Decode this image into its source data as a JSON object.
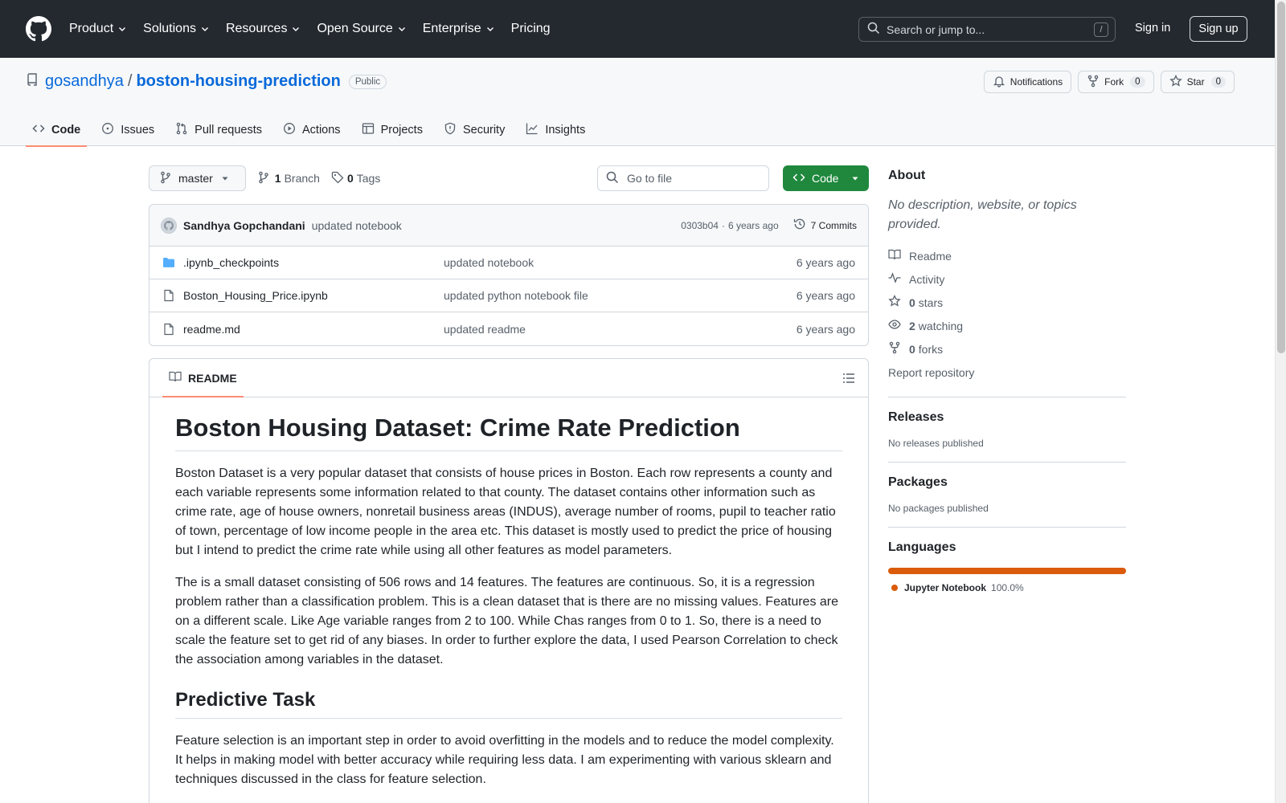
{
  "header": {
    "nav": [
      "Product",
      "Solutions",
      "Resources",
      "Open Source",
      "Enterprise",
      "Pricing"
    ],
    "search_placeholder": "Search or jump to...",
    "search_shortcut": "/",
    "sign_in": "Sign in",
    "sign_up": "Sign up"
  },
  "repo": {
    "owner": "gosandhya",
    "separator": "/",
    "name": "boston-housing-prediction",
    "visibility": "Public",
    "actions": {
      "notifications": "Notifications",
      "fork_label": "Fork",
      "fork_count": "0",
      "star_label": "Star",
      "star_count": "0"
    },
    "tabs": [
      "Code",
      "Issues",
      "Pull requests",
      "Actions",
      "Projects",
      "Security",
      "Insights"
    ]
  },
  "toolbar": {
    "branch": "master",
    "branch_count": "1",
    "branch_label": "Branch",
    "tag_count": "0",
    "tag_label": "Tags",
    "goto_placeholder": "Go to file",
    "code_label": "Code"
  },
  "commit": {
    "author": "Sandhya Gopchandani",
    "message": "updated notebook",
    "hash": "0303b04",
    "dot": "·",
    "time": "6 years ago",
    "commits": "7 Commits"
  },
  "files": [
    {
      "name": ".ipynb_checkpoints",
      "type": "folder",
      "message": "updated notebook",
      "date": "6 years ago"
    },
    {
      "name": "Boston_Housing_Price.ipynb",
      "type": "file",
      "message": "updated python notebook file",
      "date": "6 years ago"
    },
    {
      "name": "readme.md",
      "type": "file",
      "message": "updated readme",
      "date": "6 years ago"
    }
  ],
  "readme": {
    "tab_label": "README",
    "title": "Boston Housing Dataset: Crime Rate Prediction",
    "p1": "Boston Dataset is a very popular dataset that consists of house prices in Boston. Each row represents a county and each variable represents some information related to that county. The dataset contains other information such as crime rate, age of house owners, nonretail business areas (INDUS), average number of rooms, pupil to teacher ratio of town, percentage of low income people in the area etc. This dataset is mostly used to predict the price of housing but I intend to predict the crime rate while using all other features as model parameters.",
    "p2": "The is a small dataset consisting of 506 rows and 14 features. The features are continuous. So, it is a regression problem rather than a classification problem. This is a clean dataset that is there are no missing values. Features are on a different scale. Like Age variable ranges from 2 to 100. While Chas ranges from 0 to 1. So, there is a need to scale the feature set to get rid of any biases. In order to further explore the data, I used Pearson Correlation to check the association among variables in the dataset.",
    "h2": "Predictive Task",
    "p3": "Feature selection is an important step in order to avoid overfitting in the models and to reduce the model complexity. It helps in making model with better accuracy while requiring less data. I am experimenting with various sklearn and techniques discussed in the class for feature selection."
  },
  "sidebar": {
    "about_title": "About",
    "about_desc": "No description, website, or topics provided.",
    "readme": "Readme",
    "activity": "Activity",
    "stars_count": "0",
    "stars_label": "stars",
    "watching_count": "2",
    "watching_label": "watching",
    "forks_count": "0",
    "forks_label": "forks",
    "report": "Report repository",
    "releases_title": "Releases",
    "releases_desc": "No releases published",
    "packages_title": "Packages",
    "packages_desc": "No packages published",
    "languages_title": "Languages",
    "language_name": "Jupyter Notebook",
    "language_pct": "100.0%",
    "language_color": "#da5b0b"
  },
  "colors": {
    "header_bg": "#24292f",
    "link": "#0969da",
    "code_button": "#1f883d",
    "tab_underline": "#fd8c73",
    "folder_icon": "#54aeff"
  }
}
